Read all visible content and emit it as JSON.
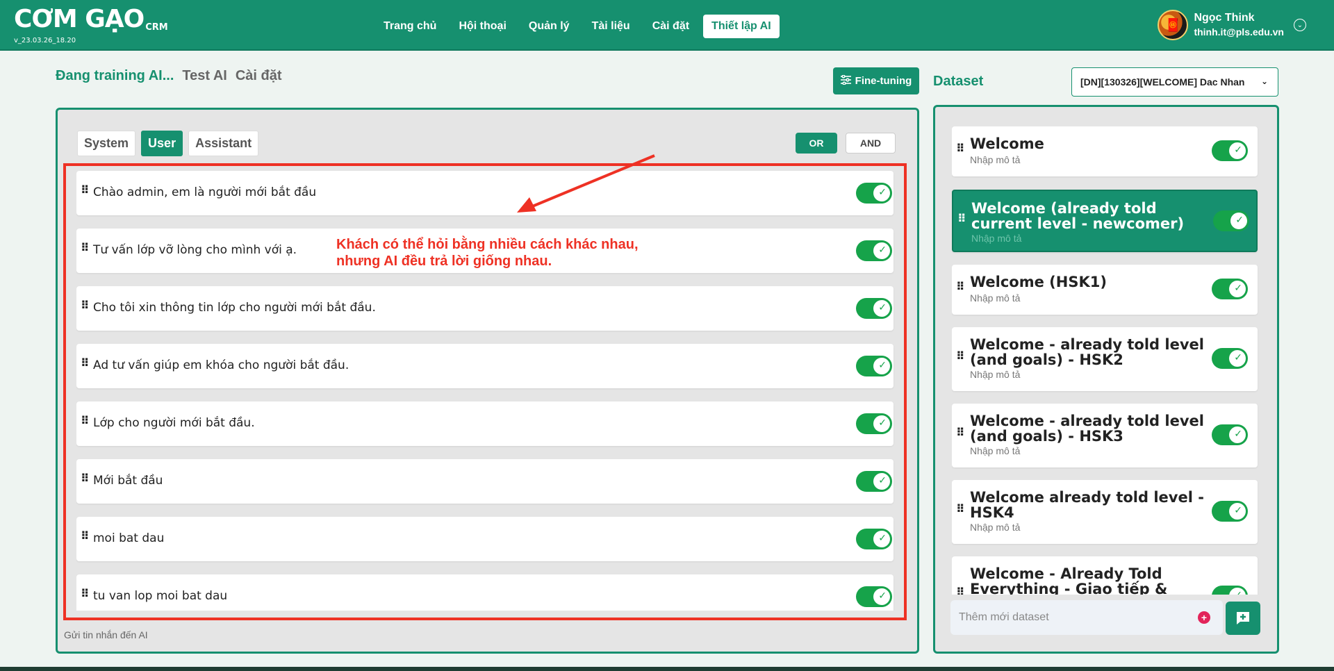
{
  "header": {
    "logo_main": "CƠM GẠO",
    "logo_sub": "CRM",
    "version": "v_23.03.26_18.20",
    "nav": [
      {
        "label": "Trang chủ",
        "active": false
      },
      {
        "label": "Hội thoại",
        "active": false
      },
      {
        "label": "Quản lý",
        "active": false
      },
      {
        "label": "Tài liệu",
        "active": false
      },
      {
        "label": "Cài đặt",
        "active": false
      },
      {
        "label": "Thiết lập AI",
        "active": true
      }
    ],
    "user": {
      "name": "Ngọc Think",
      "email": "thinh.it@pls.edu.vn",
      "avatar_icon": "avatar-icon"
    }
  },
  "page_tabs": [
    {
      "label": "Đang training AI...",
      "active": true
    },
    {
      "label": "Test AI",
      "active": false
    },
    {
      "label": "Cài đặt",
      "active": false
    }
  ],
  "finetune": {
    "label": "Fine-tuning",
    "icon": "sliders-icon"
  },
  "role_tabs": [
    {
      "label": "System",
      "active": false
    },
    {
      "label": "User",
      "active": true
    },
    {
      "label": "Assistant",
      "active": false
    }
  ],
  "logic": {
    "or_label": "OR",
    "and_label": "AND",
    "selected": "OR"
  },
  "messages": [
    {
      "text": "Chào admin, em là người mới bắt đầu",
      "enabled": true
    },
    {
      "text": "Tư vấn lớp vỡ lòng cho mình với ạ.",
      "enabled": true
    },
    {
      "text": "Cho tôi xin thông tin lớp cho người mới bắt đầu.",
      "enabled": true
    },
    {
      "text": "Ad tư vấn giúp em khóa cho người bắt đầu.",
      "enabled": true
    },
    {
      "text": "Lớp cho người mới bắt đầu.",
      "enabled": true
    },
    {
      "text": "Mới bắt đầu",
      "enabled": true
    },
    {
      "text": "moi bat dau",
      "enabled": true
    },
    {
      "text": "tu van lop moi bat dau",
      "enabled": true
    }
  ],
  "send_placeholder": "Gửi tin nhắn đến AI",
  "annotation": {
    "line1": "Khách có thể hỏi bằng nhiều cách khác nhau,",
    "line2": "nhưng AI đều trả lời giống nhau.",
    "color": "#ee3124"
  },
  "dataset": {
    "title": "Dataset",
    "selected": "[DN][130326][WELCOME] Dac Nhan",
    "items": [
      {
        "name": "Welcome",
        "desc": "Nhập mô tả",
        "enabled": true,
        "active": false
      },
      {
        "name": "Welcome (already told current level - newcomer)",
        "desc": "Nhập mô tả",
        "enabled": true,
        "active": true
      },
      {
        "name": "Welcome (HSK1)",
        "desc": "Nhập mô tả",
        "enabled": true,
        "active": false
      },
      {
        "name": "Welcome - already told level (and goals) - HSK2",
        "desc": "Nhập mô tả",
        "enabled": true,
        "active": false
      },
      {
        "name": "Welcome - already told level (and goals) - HSK3",
        "desc": "Nhập mô tả",
        "enabled": true,
        "active": false
      },
      {
        "name": "Welcome already told level - HSK4",
        "desc": "Nhập mô tả",
        "enabled": true,
        "active": false
      },
      {
        "name": "Welcome - Already Told Everything - Giao tiếp &",
        "desc": "",
        "enabled": true,
        "active": false
      }
    ],
    "add_placeholder": "Thêm mới dataset"
  },
  "colors": {
    "brand": "#16906f",
    "toggle_on": "#16a34a",
    "annotation": "#ee3124"
  }
}
